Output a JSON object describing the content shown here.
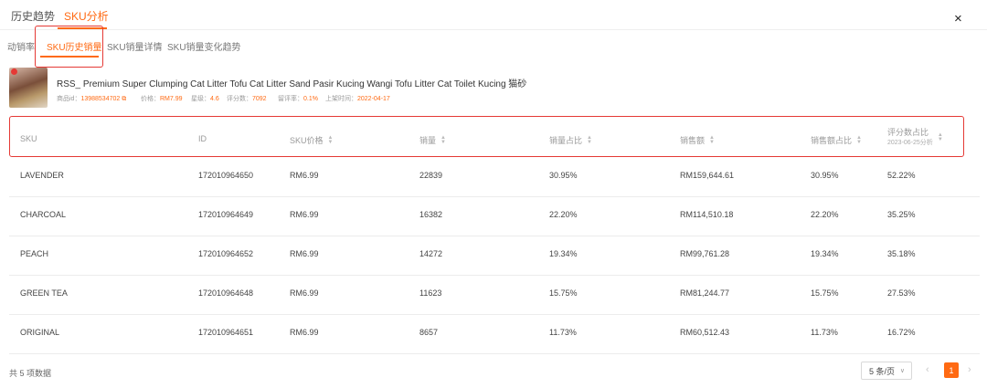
{
  "top_tabs": [
    "历史趋势",
    "SKU分析"
  ],
  "close_symbol": "×",
  "sub_tabs": [
    "动销率",
    "SKU历史销量",
    "SKU销量详情",
    "SKU销量变化趋势"
  ],
  "product": {
    "title": "RSS_ Premium Super Clumping Cat Litter Tofu Cat Litter Sand Pasir Kucing Wangi Tofu Litter Cat Toilet Kucing 猫砂",
    "meta": [
      {
        "label": "商品id：",
        "value": "13988534702"
      },
      {
        "label": "价格：",
        "value": "RM7.99"
      },
      {
        "label": "星级：",
        "value": "4.6"
      },
      {
        "label": "评分数：",
        "value": "7092"
      },
      {
        "label": "留评率：",
        "value": "0.1%"
      },
      {
        "label": "上架时间：",
        "value": "2022-04-17"
      }
    ]
  },
  "table": {
    "columns": [
      "SKU",
      "ID",
      "SKU价格",
      "销量",
      "销量占比",
      "销售额",
      "销售额占比",
      "评分数占比"
    ],
    "last_column_sub": "2023-06-25分析",
    "rows": [
      [
        "LAVENDER",
        "172010964650",
        "RM6.99",
        "22839",
        "30.95%",
        "RM159,644.61",
        "30.95%",
        "52.22%"
      ],
      [
        "CHARCOAL",
        "172010964649",
        "RM6.99",
        "16382",
        "22.20%",
        "RM114,510.18",
        "22.20%",
        "35.25%"
      ],
      [
        "PEACH",
        "172010964652",
        "RM6.99",
        "14272",
        "19.34%",
        "RM99,761.28",
        "19.34%",
        "35.18%"
      ],
      [
        "GREEN TEA",
        "172010964648",
        "RM6.99",
        "11623",
        "15.75%",
        "RM81,244.77",
        "15.75%",
        "27.53%"
      ],
      [
        "ORIGINAL",
        "172010964651",
        "RM6.99",
        "8657",
        "11.73%",
        "RM60,512.43",
        "11.73%",
        "16.72%"
      ]
    ]
  },
  "footer": {
    "total": "共 5 项数据",
    "page_size": "5 条/页",
    "current_page": "1"
  },
  "colors": {
    "accent": "#ff6a13",
    "highlight_box": "#e53935"
  }
}
